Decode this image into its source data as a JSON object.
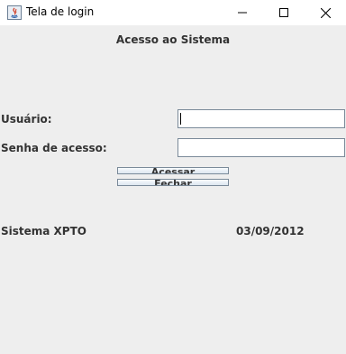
{
  "window": {
    "title": "Tela de login",
    "icon": "java-icon",
    "controls": [
      "minimize-icon",
      "maximize-icon",
      "close-icon"
    ]
  },
  "form": {
    "header": "Acesso ao Sistema",
    "user_label": "Usuário:",
    "user_value": "",
    "password_label": "Senha de acesso:",
    "password_value": "",
    "submit_label": "Acessar",
    "close_label": "Fechar"
  },
  "footer": {
    "system_name": "Sistema XPTO",
    "date": "03/09/2012"
  },
  "colors": {
    "background": "#eeeeee",
    "titlebar": "#ffffff",
    "text": "#333333",
    "field_border": "#7a8a99"
  }
}
